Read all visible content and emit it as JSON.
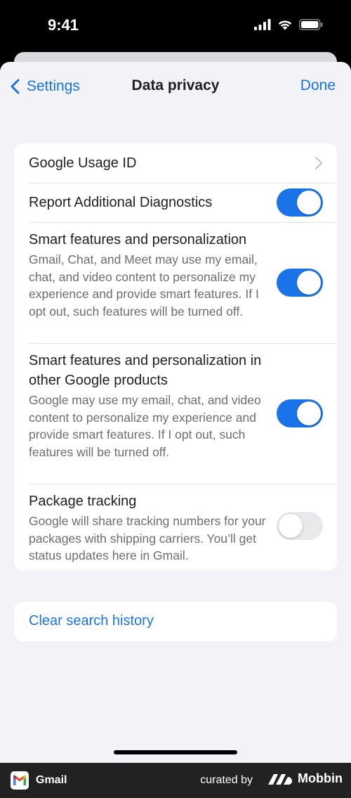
{
  "status_bar": {
    "time": "9:41",
    "icons": [
      "cellular-signal-icon",
      "wifi-icon",
      "battery-icon"
    ]
  },
  "nav": {
    "back_label": "Settings",
    "title": "Data privacy",
    "done_label": "Done"
  },
  "settings": {
    "usage_id": {
      "title": "Google Usage ID"
    },
    "diagnostics": {
      "title": "Report Additional Diagnostics",
      "enabled": true
    },
    "smart_features": {
      "title": "Smart features and personalization",
      "description": "Gmail, Chat, and Meet may use my email, chat, and video content to personalize my experience and provide smart features. If I opt out, such features will be turned off.",
      "enabled": true
    },
    "smart_features_other": {
      "title": "Smart features and personalization in other Google products",
      "description": "Google may use my email, chat, and video content to personalize my experience and provide smart features. If I opt out, such features will be turned off.",
      "enabled": true
    },
    "package_tracking": {
      "title": "Package tracking",
      "description": "Google will share tracking numbers for your packages with shipping carriers. You’ll get status updates here in Gmail.",
      "enabled": false
    }
  },
  "clear_history": {
    "label": "Clear search history"
  },
  "footer": {
    "app_name": "Gmail",
    "curated_by": "curated by",
    "brand": "Mobbin"
  },
  "colors": {
    "accent": "#1a73e8",
    "toggle_off": "#e9e9eb",
    "background": "#f2f2f7"
  }
}
